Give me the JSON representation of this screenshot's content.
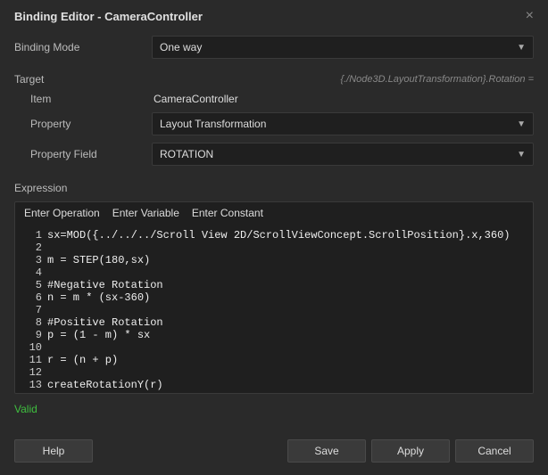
{
  "window_title": "Binding Editor - CameraController",
  "binding_mode": {
    "label": "Binding Mode",
    "selected": "One way"
  },
  "target": {
    "label": "Target",
    "path": "{./Node3D.LayoutTransformation}.Rotation =",
    "item_label": "Item",
    "item_value": "CameraController",
    "property_label": "Property",
    "property_selected": "Layout Transformation",
    "field_label": "Property Field",
    "field_selected": "ROTATION"
  },
  "expression": {
    "label": "Expression",
    "toolbar": {
      "operation": "Enter Operation",
      "variable": "Enter Variable",
      "constant": "Enter Constant"
    },
    "lines": [
      "sx=MOD({../../../Scroll View 2D/ScrollViewConcept.ScrollPosition}.x,360)",
      "",
      "m = STEP(180,sx)",
      "",
      "#Negative Rotation",
      "n = m * (sx-360)",
      "",
      "#Positive Rotation",
      "p = (1 - m) * sx",
      "",
      "r = (n + p)",
      "",
      "createRotationY(r)"
    ],
    "status": "Valid"
  },
  "buttons": {
    "help": "Help",
    "save": "Save",
    "apply": "Apply",
    "cancel": "Cancel"
  }
}
